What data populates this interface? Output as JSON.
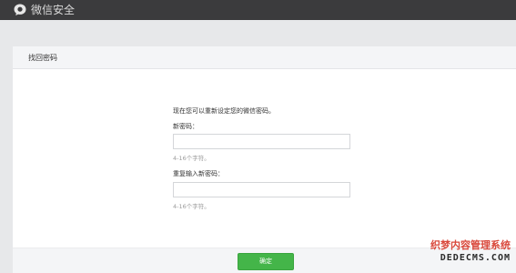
{
  "header": {
    "app_title": "微信安全",
    "logo_icon": "wechat-logo-icon"
  },
  "card": {
    "title": "找回密码",
    "intro": "现在您可以重新设定您的微信密码。",
    "new_password": {
      "label": "新密码：",
      "value": "",
      "hint": "4-16个字符。"
    },
    "confirm_password": {
      "label": "重复输入新密码：",
      "value": "",
      "hint": "4-16个字符。"
    },
    "confirm_button": "确定"
  },
  "watermark": {
    "line1": "织梦内容管理系统",
    "line2": "DEDECMS.COM"
  },
  "colors": {
    "topbar": "#3b3b3d",
    "accent_green": "#44b549",
    "page_bg": "#e7e8ea"
  }
}
